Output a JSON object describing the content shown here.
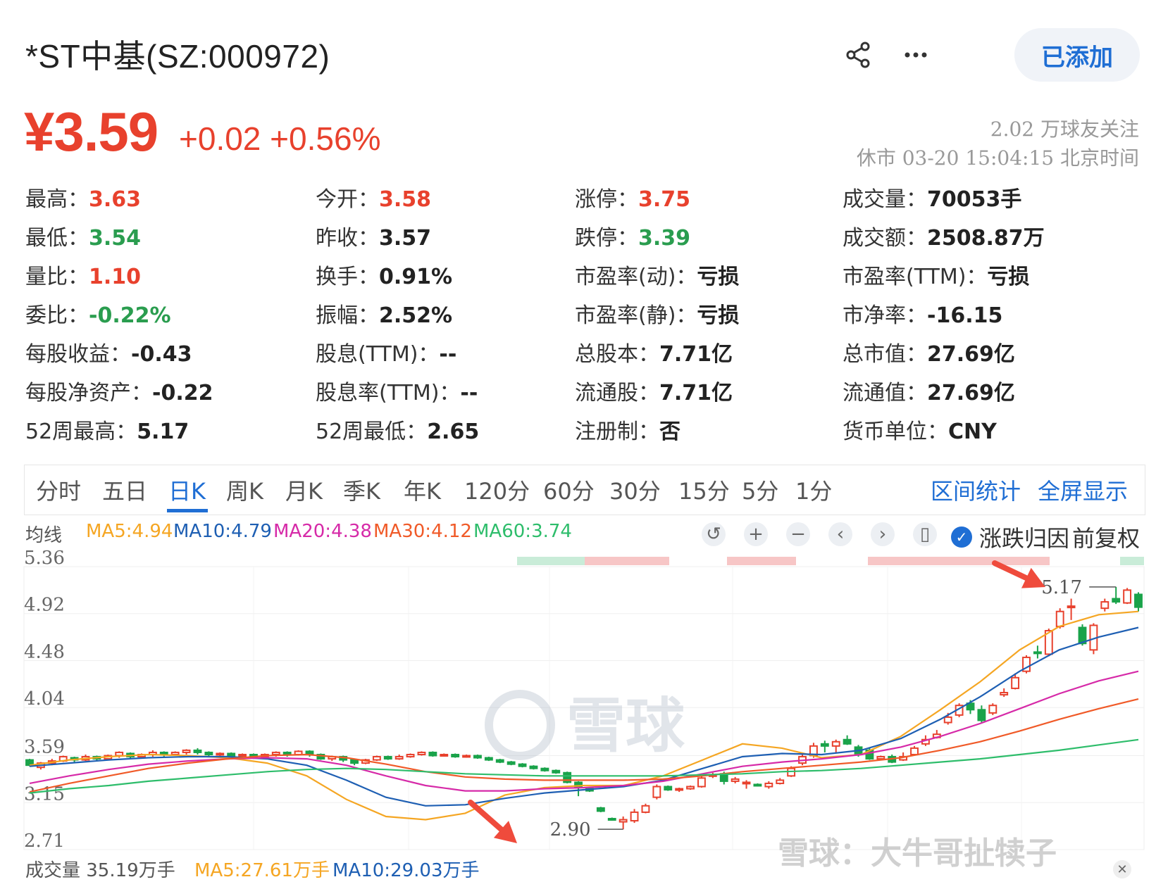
{
  "header": {
    "title": "*ST中基(SZ:000972)",
    "added_label": "已添加",
    "share_icon": "share-icon",
    "more_icon": "more-icon"
  },
  "quote": {
    "price": "¥3.59",
    "change": "+0.02 +0.56%",
    "followers": "2.02 万球友关注",
    "status": "休市 03-20 15:04:15 北京时间",
    "up_color": "#e8412d",
    "down_color": "#2a9d4f"
  },
  "stats": [
    {
      "label": "最高：",
      "value": "3.63",
      "tone": "up"
    },
    {
      "label": "今开：",
      "value": "3.58",
      "tone": "up"
    },
    {
      "label": "涨停：",
      "value": "3.75",
      "tone": "up"
    },
    {
      "label": "成交量：",
      "value": "70053手",
      "tone": ""
    },
    {
      "label": "最低：",
      "value": "3.54",
      "tone": "down"
    },
    {
      "label": "昨收：",
      "value": "3.57",
      "tone": ""
    },
    {
      "label": "跌停：",
      "value": "3.39",
      "tone": "down"
    },
    {
      "label": "成交额：",
      "value": "2508.87万",
      "tone": ""
    },
    {
      "label": "量比：",
      "value": "1.10",
      "tone": "up"
    },
    {
      "label": "换手：",
      "value": "0.91%",
      "tone": ""
    },
    {
      "label": "市盈率(动)：",
      "value": "亏损",
      "tone": ""
    },
    {
      "label": "市盈率(TTM)：",
      "value": "亏损",
      "tone": ""
    },
    {
      "label": "委比：",
      "value": "-0.22%",
      "tone": "down"
    },
    {
      "label": "振幅：",
      "value": "2.52%",
      "tone": ""
    },
    {
      "label": "市盈率(静)：",
      "value": "亏损",
      "tone": ""
    },
    {
      "label": "市净率：",
      "value": "-16.15",
      "tone": ""
    },
    {
      "label": "每股收益：",
      "value": "-0.43",
      "tone": ""
    },
    {
      "label": "股息(TTM)：",
      "value": "--",
      "tone": ""
    },
    {
      "label": "总股本：",
      "value": "7.71亿",
      "tone": ""
    },
    {
      "label": "总市值：",
      "value": "27.69亿",
      "tone": ""
    },
    {
      "label": "每股净资产：",
      "value": "-0.22",
      "tone": ""
    },
    {
      "label": "股息率(TTM)：",
      "value": "--",
      "tone": ""
    },
    {
      "label": "流通股：",
      "value": "7.71亿",
      "tone": ""
    },
    {
      "label": "流通值：",
      "value": "27.69亿",
      "tone": ""
    },
    {
      "label": "52周最高：",
      "value": "5.17",
      "tone": ""
    },
    {
      "label": "52周最低：",
      "value": "2.65",
      "tone": ""
    },
    {
      "label": "注册制：",
      "value": "否",
      "tone": ""
    },
    {
      "label": "货币单位：",
      "value": "CNY",
      "tone": ""
    }
  ],
  "tabs": [
    "分时",
    "五日",
    "日K",
    "周K",
    "月K",
    "季K",
    "年K",
    "120分",
    "60分",
    "30分",
    "15分",
    "5分",
    "1分"
  ],
  "active_tab": "日K",
  "tab_actions": [
    "区间统计",
    "全屏显示"
  ],
  "ma_legend": {
    "label": "均线",
    "items": [
      {
        "text": "MA5:4.94",
        "color": "#f5a623"
      },
      {
        "text": "MA10:4.79",
        "color": "#1e5fb3"
      },
      {
        "text": "MA20:4.38",
        "color": "#d62aa8"
      },
      {
        "text": "MA30:4.12",
        "color": "#f05a28"
      },
      {
        "text": "MA60:3.74",
        "color": "#2ebd6b"
      }
    ]
  },
  "chart_controls": {
    "icons": [
      "undo-icon",
      "zoom-in-icon",
      "zoom-out-icon",
      "left-icon",
      "right-icon",
      "candle-icon"
    ],
    "options": [
      "涨跌归因",
      "前复权"
    ]
  },
  "chart_data": {
    "type": "candlestick",
    "ylim": [
      2.71,
      5.36
    ],
    "y_ticks": [
      "5.36",
      "4.92",
      "4.48",
      "4.04",
      "3.59",
      "3.15",
      "2.71"
    ],
    "annotations": {
      "high": "5.17",
      "low": "2.90"
    },
    "watermark": "雪球",
    "candles": [
      [
        3.55,
        3.5,
        3.56,
        3.49
      ],
      [
        3.48,
        3.52,
        3.53,
        3.46
      ],
      [
        3.52,
        3.54,
        3.56,
        3.5
      ],
      [
        3.54,
        3.58,
        3.59,
        3.53
      ],
      [
        3.57,
        3.55,
        3.58,
        3.53
      ],
      [
        3.55,
        3.58,
        3.6,
        3.54
      ],
      [
        3.58,
        3.56,
        3.59,
        3.54
      ],
      [
        3.56,
        3.59,
        3.6,
        3.55
      ],
      [
        3.59,
        3.62,
        3.63,
        3.57
      ],
      [
        3.61,
        3.58,
        3.62,
        3.56
      ],
      [
        3.58,
        3.6,
        3.61,
        3.57
      ],
      [
        3.6,
        3.62,
        3.64,
        3.58
      ],
      [
        3.62,
        3.6,
        3.63,
        3.58
      ],
      [
        3.6,
        3.62,
        3.63,
        3.59
      ],
      [
        3.62,
        3.64,
        3.65,
        3.6
      ],
      [
        3.64,
        3.62,
        3.66,
        3.6
      ],
      [
        3.62,
        3.6,
        3.63,
        3.58
      ],
      [
        3.6,
        3.61,
        3.62,
        3.58
      ],
      [
        3.61,
        3.59,
        3.62,
        3.57
      ],
      [
        3.59,
        3.6,
        3.61,
        3.57
      ],
      [
        3.6,
        3.58,
        3.61,
        3.56
      ],
      [
        3.58,
        3.6,
        3.61,
        3.57
      ],
      [
        3.6,
        3.62,
        3.63,
        3.58
      ],
      [
        3.62,
        3.6,
        3.63,
        3.58
      ],
      [
        3.6,
        3.63,
        3.64,
        3.59
      ],
      [
        3.63,
        3.6,
        3.64,
        3.58
      ],
      [
        3.6,
        3.56,
        3.61,
        3.55
      ],
      [
        3.56,
        3.58,
        3.59,
        3.54
      ],
      [
        3.58,
        3.55,
        3.59,
        3.53
      ],
      [
        3.55,
        3.52,
        3.56,
        3.5
      ],
      [
        3.52,
        3.55,
        3.56,
        3.51
      ],
      [
        3.55,
        3.58,
        3.59,
        3.54
      ],
      [
        3.58,
        3.56,
        3.59,
        3.55
      ],
      [
        3.56,
        3.58,
        3.6,
        3.55
      ],
      [
        3.58,
        3.6,
        3.61,
        3.57
      ],
      [
        3.6,
        3.62,
        3.63,
        3.59
      ],
      [
        3.62,
        3.59,
        3.63,
        3.58
      ],
      [
        3.59,
        3.6,
        3.61,
        3.58
      ],
      [
        3.6,
        3.58,
        3.61,
        3.57
      ],
      [
        3.58,
        3.59,
        3.6,
        3.57
      ],
      [
        3.59,
        3.57,
        3.6,
        3.56
      ],
      [
        3.57,
        3.55,
        3.58,
        3.54
      ],
      [
        3.55,
        3.53,
        3.56,
        3.52
      ],
      [
        3.53,
        3.51,
        3.54,
        3.5
      ],
      [
        3.51,
        3.49,
        3.52,
        3.48
      ],
      [
        3.49,
        3.47,
        3.5,
        3.46
      ],
      [
        3.47,
        3.45,
        3.48,
        3.44
      ],
      [
        3.45,
        3.43,
        3.46,
        3.42
      ],
      [
        3.43,
        3.34,
        3.44,
        3.33
      ],
      [
        3.34,
        3.3,
        3.35,
        3.21
      ],
      [
        3.28,
        3.26,
        3.29,
        3.25
      ],
      [
        3.1,
        3.07,
        3.11,
        3.06
      ],
      [
        3.0,
        2.99,
        3.01,
        2.98
      ],
      [
        2.97,
        2.99,
        3.02,
        2.9
      ],
      [
        2.98,
        3.06,
        3.09,
        2.96
      ],
      [
        3.06,
        3.12,
        3.14,
        3.05
      ],
      [
        3.2,
        3.3,
        3.32,
        3.18
      ],
      [
        3.3,
        3.27,
        3.31,
        3.26
      ],
      [
        3.27,
        3.28,
        3.29,
        3.25
      ],
      [
        3.28,
        3.3,
        3.31,
        3.27
      ],
      [
        3.3,
        3.38,
        3.4,
        3.29
      ],
      [
        3.4,
        3.41,
        3.43,
        3.38
      ],
      [
        3.42,
        3.35,
        3.44,
        3.32
      ],
      [
        3.35,
        3.37,
        3.39,
        3.33
      ],
      [
        3.33,
        3.34,
        3.36,
        3.28
      ],
      [
        3.32,
        3.31,
        3.33,
        3.3
      ],
      [
        3.3,
        3.33,
        3.35,
        3.28
      ],
      [
        3.33,
        3.36,
        3.38,
        3.32
      ],
      [
        3.4,
        3.47,
        3.49,
        3.39
      ],
      [
        3.52,
        3.58,
        3.61,
        3.5
      ],
      [
        3.59,
        3.68,
        3.71,
        3.57
      ],
      [
        3.7,
        3.68,
        3.73,
        3.62
      ],
      [
        3.68,
        3.72,
        3.74,
        3.62
      ],
      [
        3.74,
        3.7,
        3.78,
        3.69
      ],
      [
        3.67,
        3.6,
        3.69,
        3.58
      ],
      [
        3.64,
        3.56,
        3.66,
        3.55
      ],
      [
        3.56,
        3.58,
        3.59,
        3.55
      ],
      [
        3.58,
        3.53,
        3.6,
        3.52
      ],
      [
        3.55,
        3.58,
        3.62,
        3.54
      ],
      [
        3.6,
        3.66,
        3.68,
        3.59
      ],
      [
        3.7,
        3.74,
        3.78,
        3.68
      ],
      [
        3.76,
        3.79,
        3.83,
        3.75
      ],
      [
        3.9,
        3.95,
        3.99,
        3.88
      ],
      [
        3.97,
        4.06,
        4.08,
        3.95
      ],
      [
        4.08,
        4.02,
        4.11,
        3.98
      ],
      [
        4.02,
        3.92,
        4.06,
        3.9
      ],
      [
        3.99,
        4.06,
        4.08,
        3.97
      ],
      [
        4.16,
        4.18,
        4.22,
        4.14
      ],
      [
        4.22,
        4.32,
        4.36,
        4.21
      ],
      [
        4.38,
        4.51,
        4.53,
        4.36
      ],
      [
        4.56,
        4.55,
        4.62,
        4.5
      ],
      [
        4.54,
        4.76,
        4.78,
        4.52
      ],
      [
        4.8,
        4.94,
        4.97,
        4.78
      ],
      [
        4.99,
        4.99,
        5.06,
        4.86
      ],
      [
        4.79,
        4.64,
        4.82,
        4.62
      ],
      [
        4.58,
        4.81,
        4.83,
        4.54
      ],
      [
        4.97,
        5.03,
        5.06,
        4.94
      ],
      [
        5.06,
        5.03,
        5.17,
        5.01
      ],
      [
        5.02,
        5.14,
        5.16,
        5.01
      ],
      [
        5.1,
        4.98,
        5.12,
        4.94
      ]
    ],
    "ma_lines": [
      {
        "name": "MA5",
        "color": "#f5a623",
        "values": [
          3.5,
          3.55,
          3.58,
          3.6,
          3.59,
          3.57,
          3.52,
          3.4,
          3.18,
          3.02,
          2.99,
          3.05,
          3.22,
          3.29,
          3.31,
          3.31,
          3.4,
          3.55,
          3.7,
          3.66,
          3.57,
          3.6,
          3.77,
          4.02,
          4.28,
          4.58,
          4.8,
          4.91,
          4.94
        ]
      },
      {
        "name": "MA10",
        "color": "#1e5fb3",
        "values": [
          3.49,
          3.52,
          3.55,
          3.57,
          3.58,
          3.58,
          3.56,
          3.5,
          3.36,
          3.2,
          3.12,
          3.13,
          3.19,
          3.24,
          3.27,
          3.3,
          3.36,
          3.47,
          3.58,
          3.61,
          3.6,
          3.64,
          3.75,
          3.93,
          4.14,
          4.38,
          4.58,
          4.7,
          4.79
        ]
      },
      {
        "name": "MA20",
        "color": "#d62aa8",
        "values": [
          3.33,
          3.4,
          3.46,
          3.51,
          3.54,
          3.56,
          3.57,
          3.56,
          3.5,
          3.4,
          3.31,
          3.26,
          3.26,
          3.28,
          3.29,
          3.31,
          3.35,
          3.42,
          3.49,
          3.53,
          3.56,
          3.6,
          3.67,
          3.77,
          3.89,
          4.03,
          4.17,
          4.29,
          4.38
        ]
      },
      {
        "name": "MA30",
        "color": "#f05a28",
        "values": [
          3.25,
          3.33,
          3.4,
          3.47,
          3.52,
          3.56,
          3.59,
          3.6,
          3.57,
          3.51,
          3.44,
          3.39,
          3.37,
          3.36,
          3.36,
          3.36,
          3.37,
          3.4,
          3.44,
          3.47,
          3.5,
          3.53,
          3.57,
          3.64,
          3.72,
          3.82,
          3.93,
          4.03,
          4.12
        ]
      },
      {
        "name": "MA60",
        "color": "#2ebd6b",
        "values": [
          3.24,
          3.28,
          3.31,
          3.35,
          3.38,
          3.41,
          3.44,
          3.46,
          3.47,
          3.46,
          3.44,
          3.42,
          3.41,
          3.4,
          3.4,
          3.4,
          3.4,
          3.41,
          3.42,
          3.44,
          3.45,
          3.47,
          3.5,
          3.53,
          3.56,
          3.6,
          3.64,
          3.69,
          3.74
        ]
      }
    ]
  },
  "volume_legend": {
    "total": "成交量 35.19万手",
    "items": [
      {
        "text": "MA5:27.61万手",
        "color": "#f5a623"
      },
      {
        "text": "MA10:29.03万手",
        "color": "#1e5fb3"
      }
    ]
  },
  "footer_watermark": "雪球：大牛哥扯犊子"
}
